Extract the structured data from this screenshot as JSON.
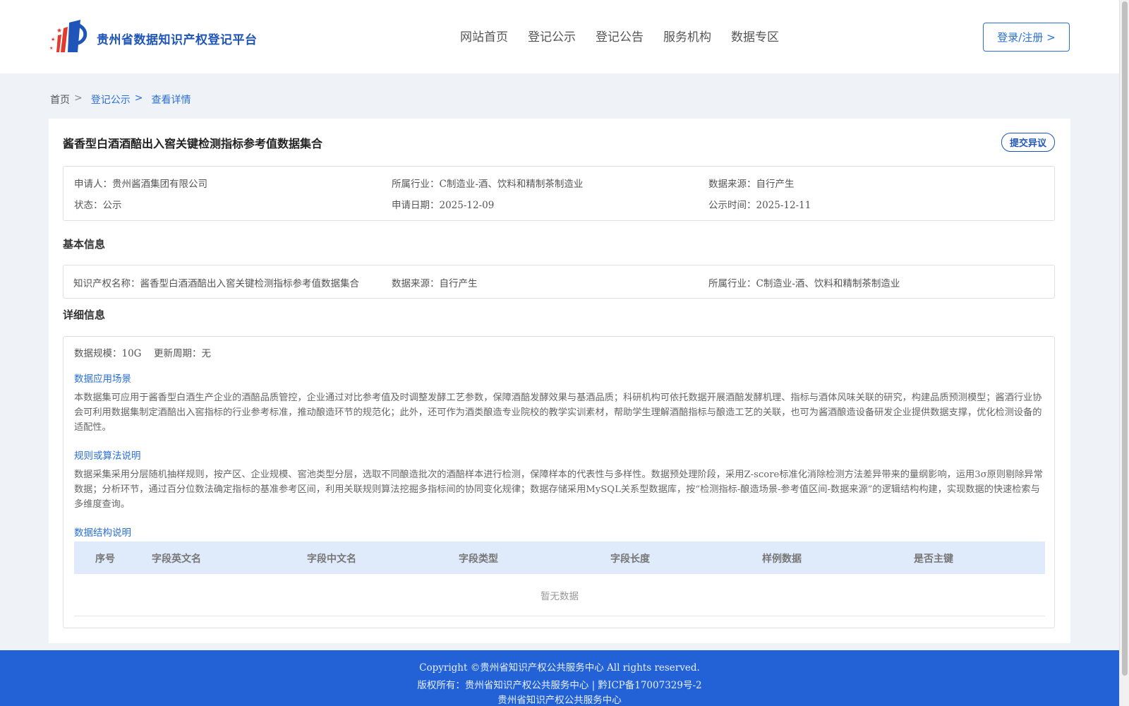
{
  "header": {
    "site_title": "贵州省数据知识产权登记平台",
    "nav": [
      "网站首页",
      "登记公示",
      "登记公告",
      "服务机构",
      "数据专区"
    ],
    "login_label": "登录/注册 >"
  },
  "breadcrumb": {
    "home": "首页",
    "sep": ">",
    "level1": "登记公示",
    "level2": "查看详情"
  },
  "detail": {
    "title": "酱香型白酒酒醅出入窖关键检测指标参考值数据集合",
    "objection_label": "提交异议",
    "summary": {
      "applicant_label": "申请人：",
      "applicant": "贵州酱酒集团有限公司",
      "industry_label": "所属行业：",
      "industry": "C制造业-酒、饮料和精制茶制造业",
      "source_label": "数据来源：",
      "source": "自行产生",
      "status_label": "状态：",
      "status": "公示",
      "apply_date_label": "申请日期：",
      "apply_date": "2025-12-09",
      "publish_date_label": "公示时间：",
      "publish_date": "2025-12-11"
    },
    "basic": {
      "section_title": "基本信息",
      "ip_name_label": "知识产权名称：",
      "ip_name": "酱香型白酒酒醅出入窖关键检测指标参考值数据集合",
      "source_label": "数据来源：",
      "source": "自行产生",
      "industry_label": "所属行业：",
      "industry": "C制造业-酒、饮料和精制茶制造业"
    },
    "info": {
      "section_title": "详细信息",
      "scale_label": "数据规模：",
      "scale": "10G",
      "cycle_label": "更新周期：",
      "cycle": "无",
      "scenario_title": "数据应用场景",
      "scenario_text": "本数据集可应用于酱香型白酒生产企业的酒醅品质管控，企业通过对比参考值及时调整发酵工艺参数，保障酒醅发酵效果与基酒品质；科研机构可依托数据开展酒醅发酵机理、指标与酒体风味关联的研究，构建品质预测模型；酱酒行业协会可利用数据集制定酒醅出入窖指标的行业参考标准，推动酿造环节的规范化；此外，还可作为酒类酿造专业院校的教学实训素材，帮助学生理解酒醅指标与酿造工艺的关联，也可为酱酒酿造设备研发企业提供数据支撑，优化检测设备的适配性。",
      "algorithm_title": "规则或算法说明",
      "algorithm_text": "数据采集采用分层随机抽样规则，按产区、企业规模、窖池类型分层，选取不同酿造批次的酒醅样本进行检测，保障样本的代表性与多样性。数据预处理阶段，采用Z-score标准化消除检测方法差异带来的量纲影响，运用3σ原则剔除异常数据；分析环节，通过百分位数法确定指标的基准参考区间，利用关联规则算法挖掘多指标间的协同变化规律；数据存储采用MySQL关系型数据库，按“检测指标-酿造场景-参考值区间-数据来源”的逻辑结构构建，实现数据的快速检索与多维度查询。",
      "structure_title": "数据结构说明",
      "table_headers": [
        "序号",
        "字段英文名",
        "字段中文名",
        "字段类型",
        "字段长度",
        "样例数据",
        "是否主键"
      ],
      "empty_text": "暂无数据"
    }
  },
  "footer": {
    "copyright": "Copyright ©贵州省知识产权公共服务中心 All rights reserved.",
    "owner": "版权所有：贵州省知识产权公共服务中心 | 黔ICP备17007329号-2",
    "org": "贵州省知识产权公共服务中心"
  },
  "colors": {
    "accent": "#2a6fd6",
    "title_blue": "#1f55b8",
    "footer_bg": "#2262d6",
    "table_head_bg": "#dfeafa"
  }
}
